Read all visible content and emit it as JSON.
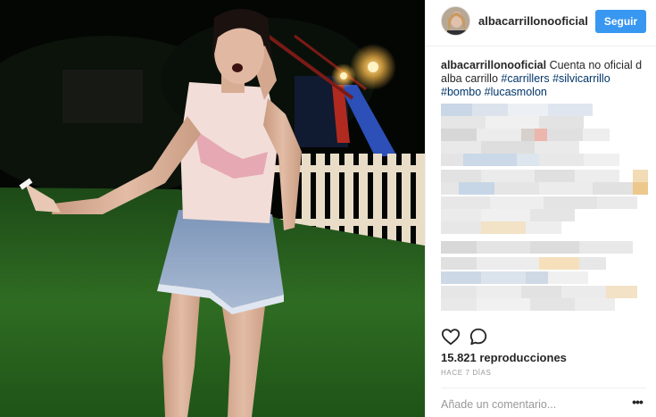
{
  "post": {
    "username": "albacarrillonooficial",
    "follow_label": "Seguir",
    "caption": {
      "username": "albacarrillonooficial",
      "text": " Cuenta no oficial d alba carrillo ",
      "hashtags": [
        "#carrillers",
        "#silvicarrillo",
        "#bombo",
        "#lucasmolon"
      ]
    },
    "views": "15.821 reproducciones",
    "time_ago": "HACE 7 DÍAS",
    "comment_placeholder": "Añade un comentario...",
    "more_label": "•••"
  },
  "icons": [
    "heart-icon",
    "comment-icon",
    "more-options-icon"
  ],
  "colors": {
    "follow_button": "#3897f0",
    "hashtag": "#003569",
    "meta_text": "#999999",
    "border": "#efefef"
  }
}
